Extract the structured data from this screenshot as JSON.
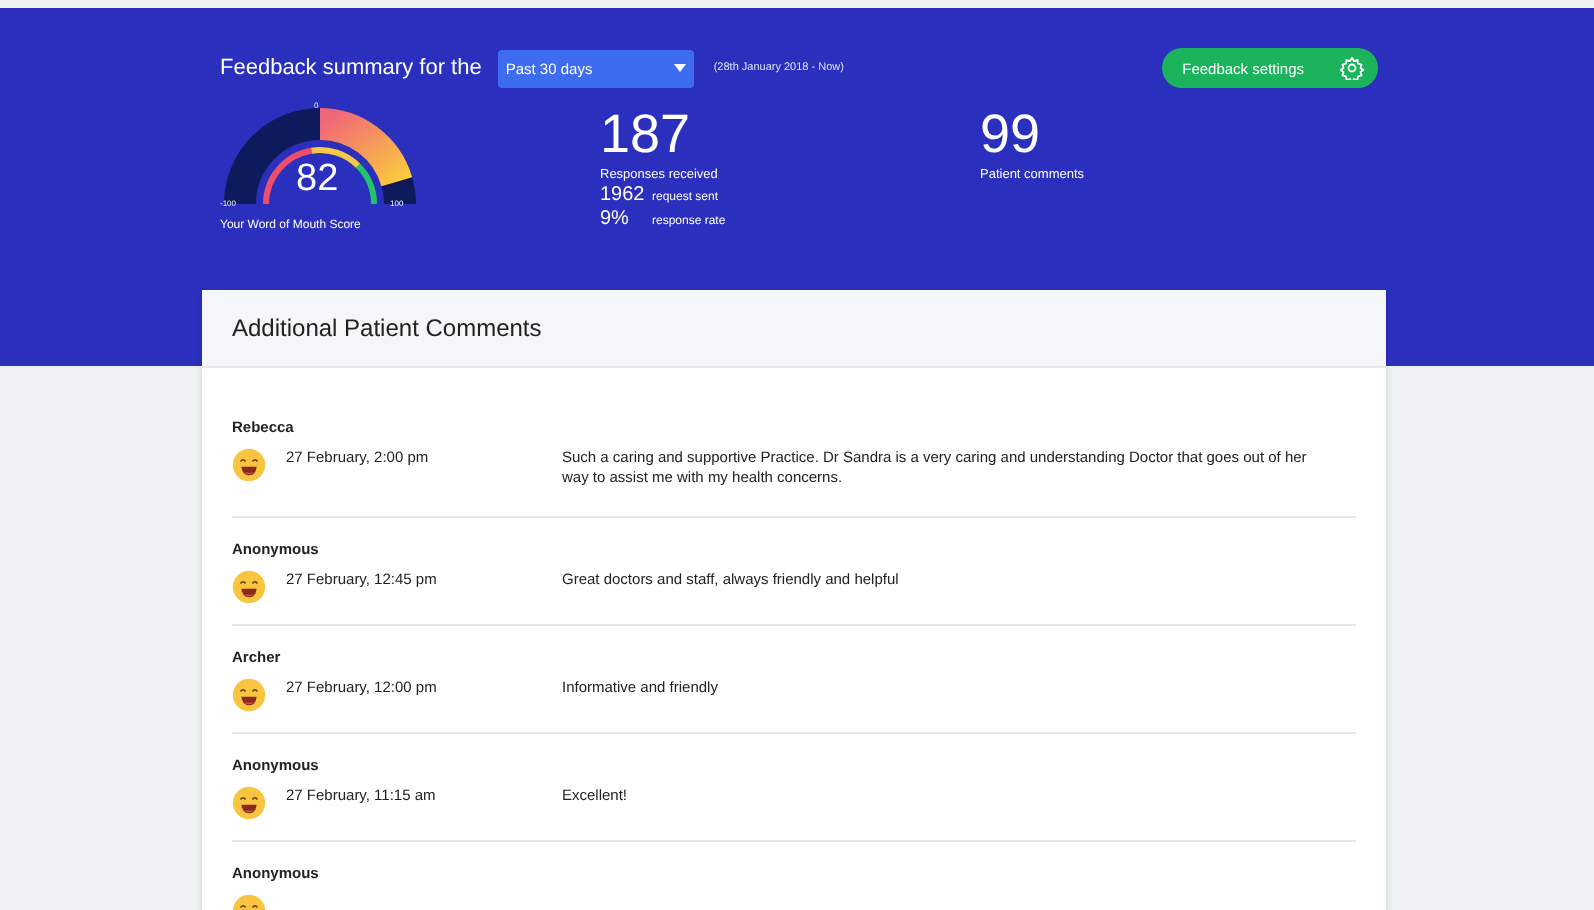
{
  "header": {
    "title": "Feedback summary for the",
    "period": {
      "value": "Past 30 days"
    },
    "range": "(28th January 2018 - Now)",
    "settings_button": "Feedback settings"
  },
  "score": {
    "value": "82",
    "min_label": "-100",
    "mid_label": "0",
    "max_label": "100",
    "caption": "Your Word of Mouth Score"
  },
  "responses": {
    "value": "187",
    "label": "Responses received",
    "requests": {
      "value": "1962",
      "label": "request sent"
    },
    "rate": {
      "value": "9%",
      "label": "response rate"
    }
  },
  "comments_count": {
    "value": "99",
    "label": "Patient comments"
  },
  "panel": {
    "title": "Additional Patient Comments",
    "comments": [
      {
        "name": "Rebecca",
        "date": "27 February, 2:00 pm",
        "text": "Such a caring and supportive Practice. Dr Sandra is a very caring and understanding Doctor that goes out of her way to assist me with my health concerns."
      },
      {
        "name": "Anonymous",
        "date": "27 February, 12:45 pm",
        "text": "Great doctors and staff, always friendly and helpful"
      },
      {
        "name": "Archer",
        "date": "27 February, 12:00 pm",
        "text": "Informative and friendly"
      },
      {
        "name": "Anonymous",
        "date": "27 February, 11:15 am",
        "text": "Excellent!"
      },
      {
        "name": "Anonymous"
      }
    ]
  }
}
